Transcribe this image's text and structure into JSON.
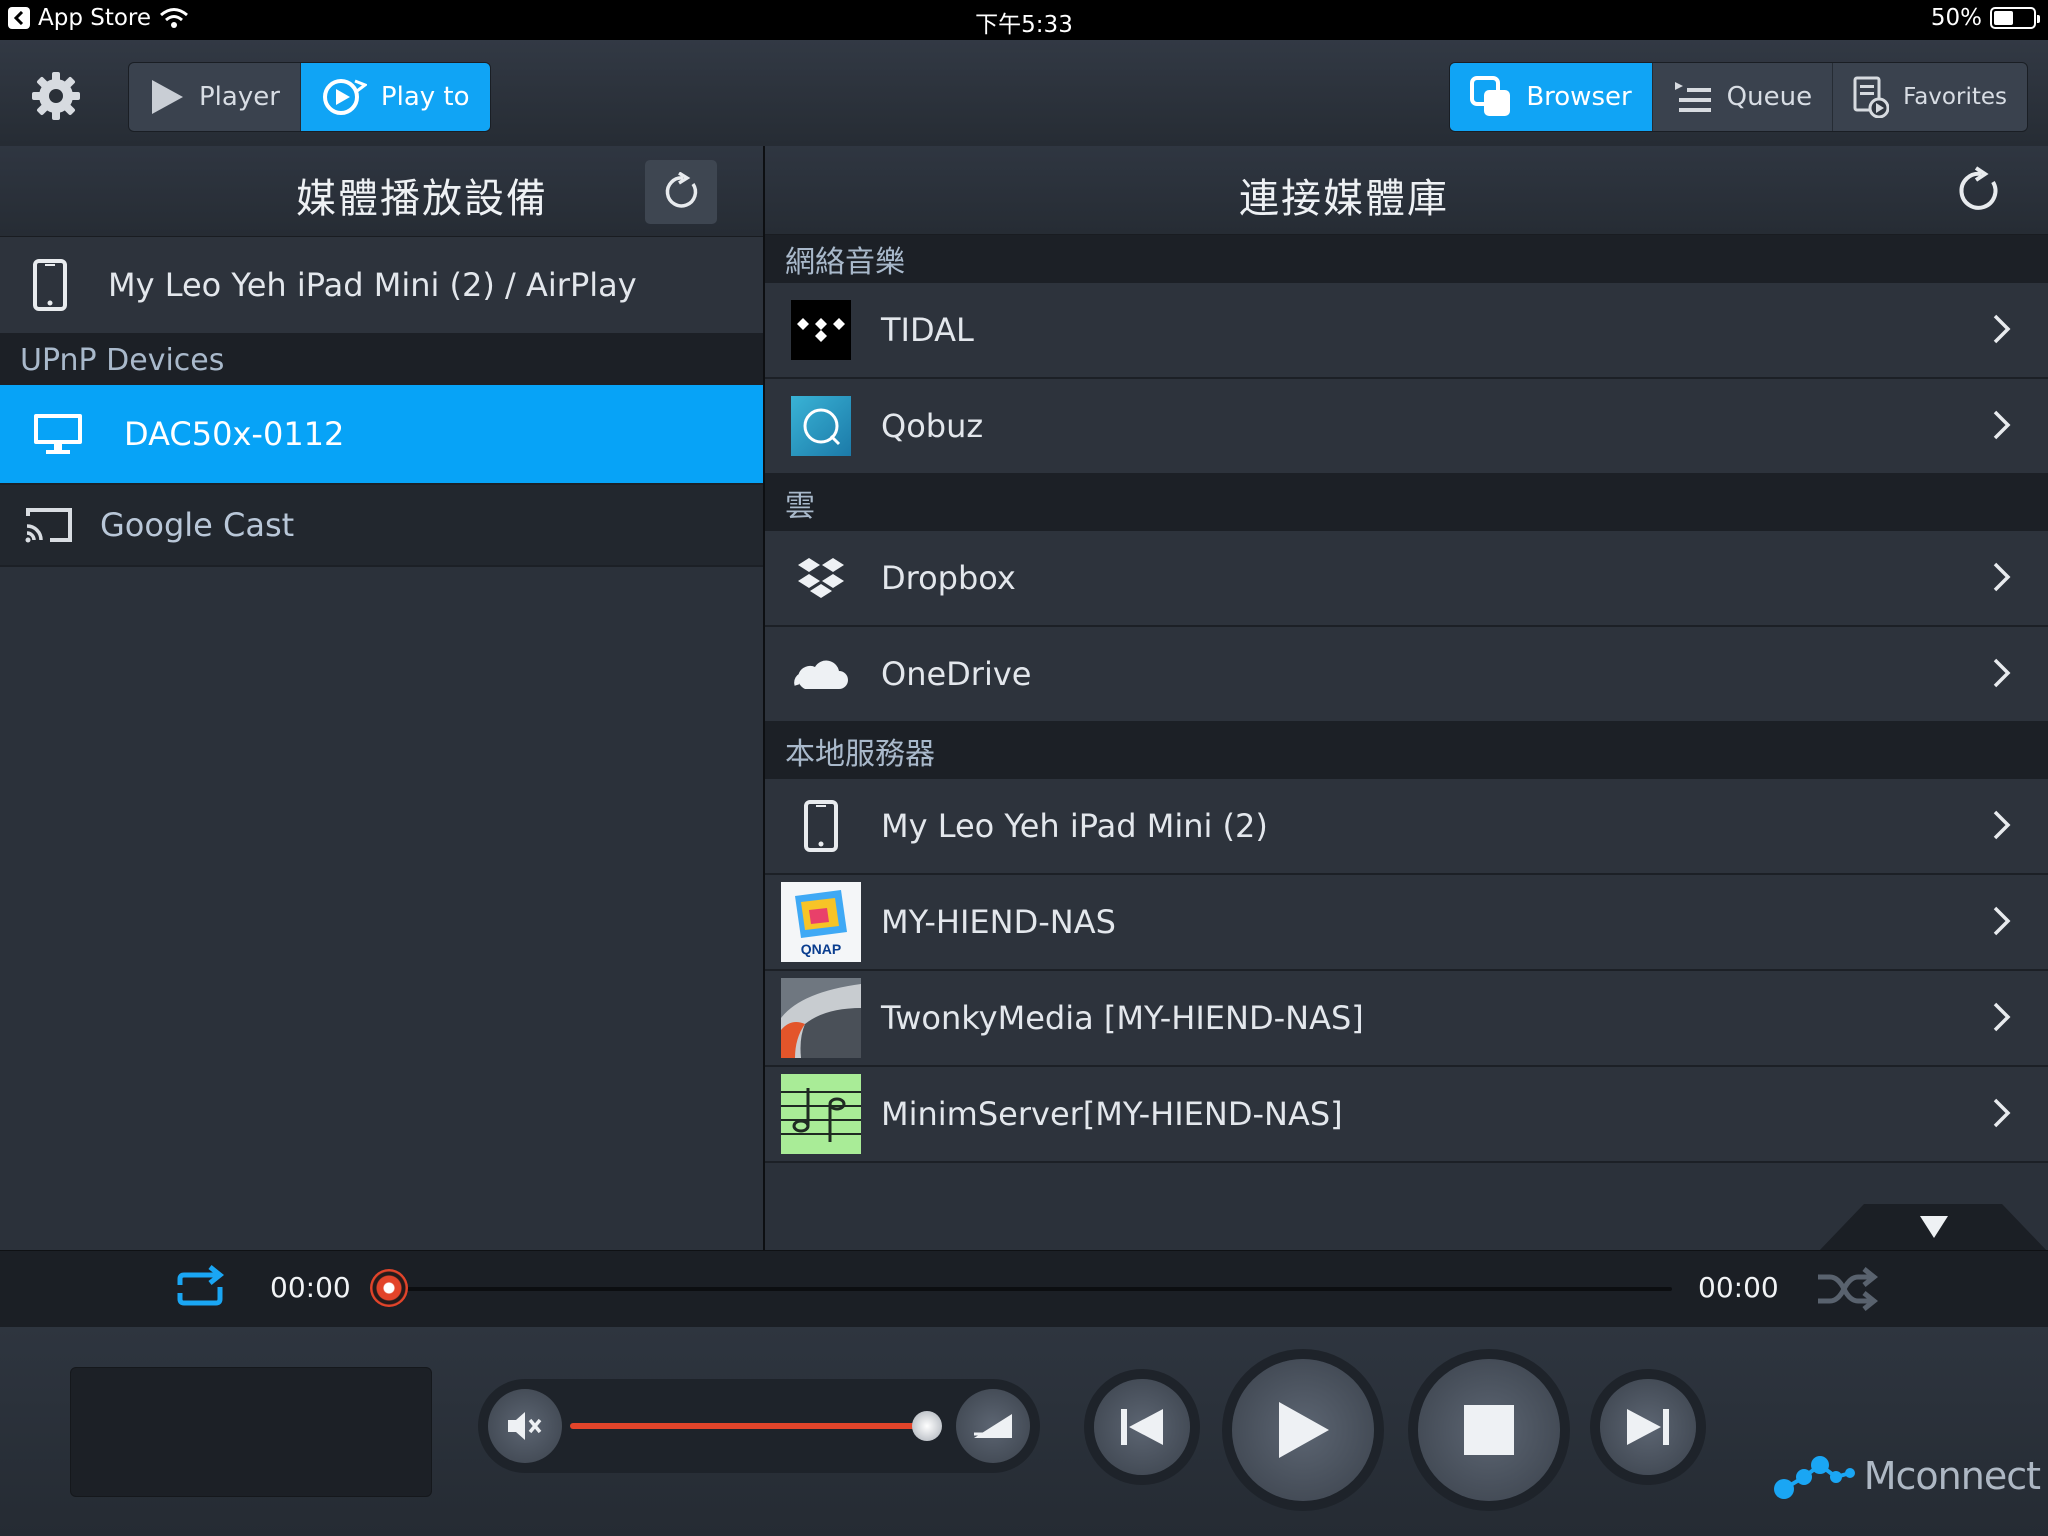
{
  "status_bar": {
    "back_app": "App Store",
    "time": "下午5:33",
    "battery": "50%"
  },
  "toolbar": {
    "left_tabs": [
      {
        "label": "Player"
      },
      {
        "label": "Play to"
      }
    ],
    "right_tabs": [
      {
        "label": "Browser"
      },
      {
        "label": "Queue"
      },
      {
        "label": "Favorites"
      }
    ]
  },
  "left": {
    "title": "媒體播放設備",
    "airplay_device": "My Leo Yeh iPad Mini (2) / AirPlay",
    "section_upnp": "UPnP Devices",
    "selected_device": "DAC50x-0112",
    "google_cast": "Google Cast"
  },
  "right": {
    "title": "連接媒體庫",
    "section_music": "網絡音樂",
    "tidal": "TIDAL",
    "qobuz": "Qobuz",
    "section_cloud": "雲",
    "dropbox": "Dropbox",
    "onedrive": "OneDrive",
    "section_local": "本地服務器",
    "local_ipad": "My Leo Yeh iPad Mini (2)",
    "nas": "MY-HIEND-NAS",
    "nas_logo_text": "QNAP",
    "twonky": "TwonkyMedia [MY-HIEND-NAS]",
    "minim": "MinimServer[MY-HIEND-NAS]"
  },
  "timeline": {
    "elapsed": "00:00",
    "remaining": "00:00",
    "progress": 0.0
  },
  "player": {
    "volume": 0.85
  },
  "brand": {
    "name": "Mconnect"
  },
  "colors": {
    "accent": "#10a4f5",
    "progress": "#e2442a",
    "background": "#2b313a"
  }
}
